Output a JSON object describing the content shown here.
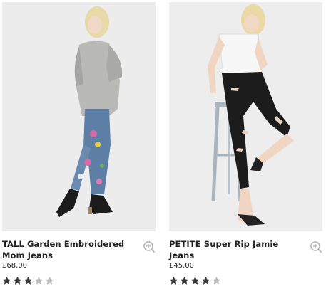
{
  "products": [
    {
      "title": "TALL Garden Embroidered Mom Jeans",
      "price": "£68.00",
      "rating": 3,
      "rating_max": 5
    },
    {
      "title": "PETITE Super Rip Jamie Jeans",
      "price": "£45.00",
      "rating": 4,
      "rating_max": 5
    }
  ],
  "colors": {
    "photo_bg": "#eeeeee",
    "star_filled": "#3a3a3a",
    "star_empty": "#bdbdbd",
    "zoom_icon": "#b0b0b0"
  }
}
